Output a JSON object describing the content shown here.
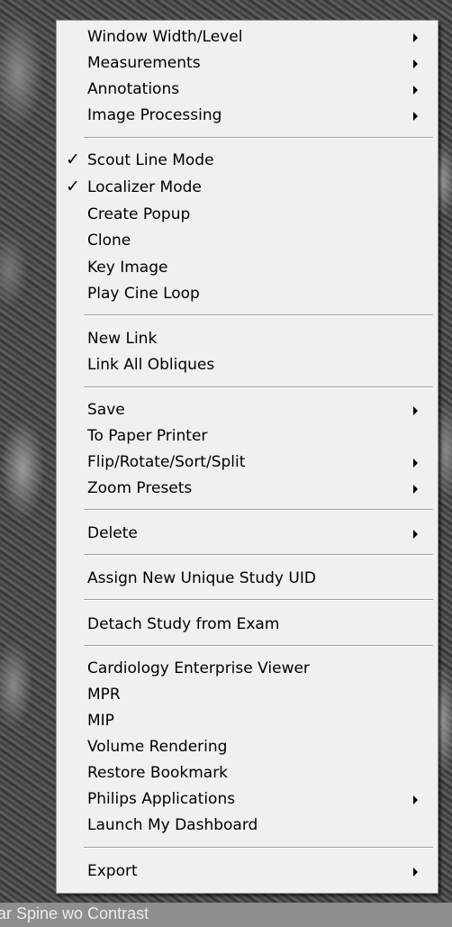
{
  "menu": {
    "items": [
      {
        "label": "Window Width/Level",
        "submenu": true,
        "checked": false
      },
      {
        "label": "Measurements",
        "submenu": true,
        "checked": false
      },
      {
        "label": "Annotations",
        "submenu": true,
        "checked": false
      },
      {
        "label": "Image Processing",
        "submenu": true,
        "checked": false
      },
      {
        "label": "Scout Line Mode",
        "submenu": false,
        "checked": true
      },
      {
        "label": "Localizer Mode",
        "submenu": false,
        "checked": true
      },
      {
        "label": "Create Popup",
        "submenu": false,
        "checked": false
      },
      {
        "label": "Clone",
        "submenu": false,
        "checked": false
      },
      {
        "label": "Key Image",
        "submenu": false,
        "checked": false
      },
      {
        "label": "Play Cine Loop",
        "submenu": false,
        "checked": false
      },
      {
        "label": "New Link",
        "submenu": false,
        "checked": false
      },
      {
        "label": "Link All Obliques",
        "submenu": false,
        "checked": false
      },
      {
        "label": "Save",
        "submenu": true,
        "checked": false
      },
      {
        "label": "To Paper Printer",
        "submenu": false,
        "checked": false
      },
      {
        "label": "Flip/Rotate/Sort/Split",
        "submenu": true,
        "checked": false
      },
      {
        "label": "Zoom Presets",
        "submenu": true,
        "checked": false
      },
      {
        "label": "Delete",
        "submenu": true,
        "checked": false
      },
      {
        "label": "Assign New Unique Study UID",
        "submenu": false,
        "checked": false
      },
      {
        "label": "Detach Study from Exam",
        "submenu": false,
        "checked": false
      },
      {
        "label": "Cardiology Enterprise Viewer",
        "submenu": false,
        "checked": false
      },
      {
        "label": "MPR",
        "submenu": false,
        "checked": false
      },
      {
        "label": "MIP",
        "submenu": false,
        "checked": false
      },
      {
        "label": "Volume Rendering",
        "submenu": false,
        "checked": false
      },
      {
        "label": "Restore Bookmark",
        "submenu": false,
        "checked": false
      },
      {
        "label": "Philips Applications",
        "submenu": true,
        "checked": false
      },
      {
        "label": "Launch My Dashboard",
        "submenu": false,
        "checked": false
      },
      {
        "label": "Export",
        "submenu": true,
        "checked": false
      }
    ],
    "check_glyph": "✓"
  },
  "viewer": {
    "series_description": "ar Spine wo Contrast"
  }
}
